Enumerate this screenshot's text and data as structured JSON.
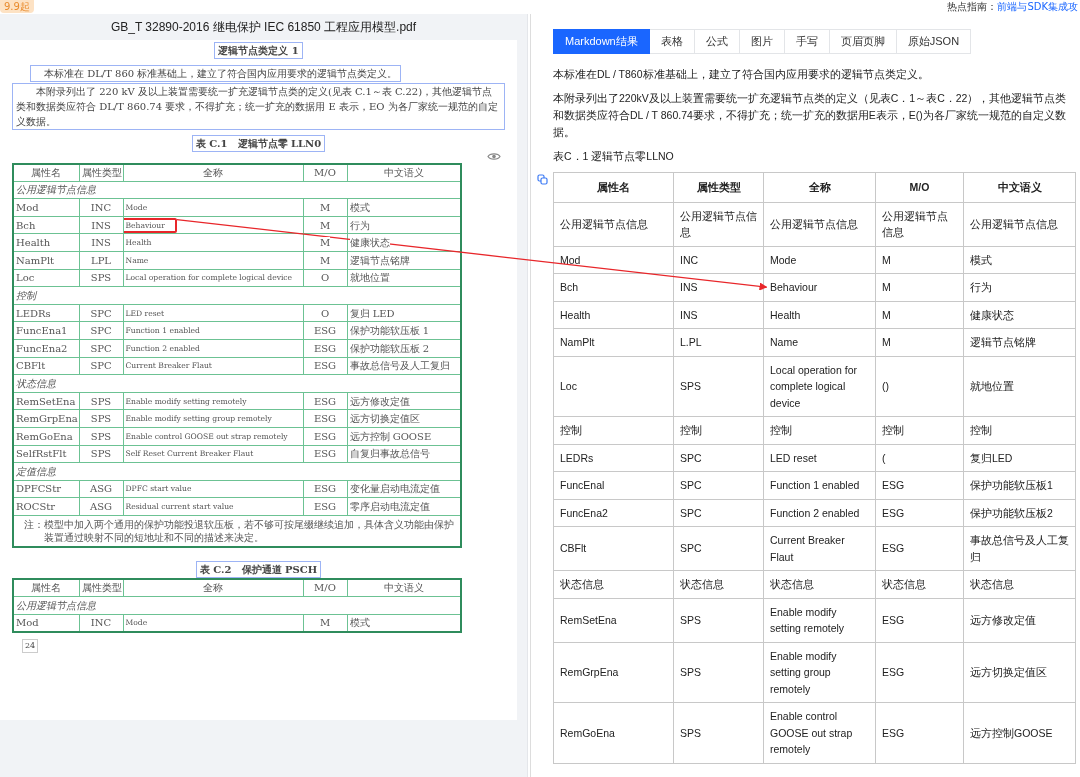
{
  "top_bar": {
    "badge": "9.9起",
    "hint_label": "热点指南：",
    "hint_link": "前端与SDK集成攻"
  },
  "pdf": {
    "title": "GB_T 32890-2016 继电保护 IEC 61850 工程应用模型.pdf",
    "section_title": "逻辑节点类定义 1",
    "paragraphs": [
      "本标准在 DL/T 860 标准基础上，建立了符合国内应用要求的逻辑节点类定义。",
      "本附录列出了 220 kV 及以上装置需要统一扩充逻辑节点类的定义(见表 C.1～表 C.22)，其他逻辑节点类和数据类应符合 DL/T 860.74 要求，不得扩充；统一扩充的数据用 E 表示，EO 为各厂家统一规范的自定义数据。"
    ],
    "tables": [
      {
        "caption": "表 C.1　逻辑节点零 LLN0",
        "columns": [
          "属性名",
          "属性类型",
          "全称",
          "M/O",
          "中文语义"
        ],
        "rows": [
          {
            "kind": "group",
            "label": "公用逻辑节点信息"
          },
          {
            "kind": "row",
            "cells": [
              "Mod",
              "INC",
              "Mode",
              "M",
              "模式"
            ]
          },
          {
            "kind": "row",
            "cells": [
              "Bch",
              "INS",
              "Behaviour",
              "M",
              "行为"
            ],
            "marked": true
          },
          {
            "kind": "row",
            "cells": [
              "Health",
              "INS",
              "Health",
              "M",
              "健康状态"
            ]
          },
          {
            "kind": "row",
            "cells": [
              "NamPlt",
              "LPL",
              "Name",
              "M",
              "逻辑节点铭牌"
            ]
          },
          {
            "kind": "row",
            "cells": [
              "Loc",
              "SPS",
              "Local operation for complete logical device",
              "O",
              "就地位置"
            ]
          },
          {
            "kind": "group",
            "label": "控制"
          },
          {
            "kind": "row",
            "cells": [
              "LEDRs",
              "SPC",
              "LED reset",
              "O",
              "复归 LED"
            ]
          },
          {
            "kind": "row",
            "cells": [
              "FuncEna1",
              "SPC",
              "Function 1 enabled",
              "ESG",
              "保护功能软压板 1"
            ]
          },
          {
            "kind": "row",
            "cells": [
              "FuncEna2",
              "SPC",
              "Function 2 enabled",
              "ESG",
              "保护功能软压板 2"
            ]
          },
          {
            "kind": "row",
            "cells": [
              "CBFlt",
              "SPC",
              "Current Breaker Flaut",
              "ESG",
              "事故总信号及人工复归"
            ]
          },
          {
            "kind": "group",
            "label": "状态信息"
          },
          {
            "kind": "row",
            "cells": [
              "RemSetEna",
              "SPS",
              "Enable modify setting remotely",
              "ESG",
              "远方修改定值"
            ]
          },
          {
            "kind": "row",
            "cells": [
              "RemGrpEna",
              "SPS",
              "Enable modify setting group remotely",
              "ESG",
              "远方切换定值区"
            ]
          },
          {
            "kind": "row",
            "cells": [
              "RemGoEna",
              "SPS",
              "Enable control GOOSE out strap remotely",
              "ESG",
              "远方控制 GOOSE"
            ]
          },
          {
            "kind": "row",
            "cells": [
              "SelfRstFlt",
              "SPS",
              "Self Reset Current Breaker Flaut",
              "ESG",
              "自复归事故总信号"
            ]
          },
          {
            "kind": "group",
            "label": "定值信息"
          },
          {
            "kind": "row",
            "cells": [
              "DPFCStr",
              "ASG",
              "DPFC start value",
              "ESG",
              "变化量启动电流定值"
            ]
          },
          {
            "kind": "row",
            "cells": [
              "ROCStr",
              "ASG",
              "Residual current start value",
              "ESG",
              "零序启动电流定值"
            ]
          },
          {
            "kind": "note",
            "label": "注：模型中加入两个通用的保护功能投退软压板，若不够可按尾缀继续追加，具体含义功能由保护装置通过映射不同的短地址和不同的描述来决定。"
          }
        ]
      },
      {
        "caption": "表 C.2　保护通道 PSCH",
        "columns": [
          "属性名",
          "属性类型",
          "全称",
          "M/O",
          "中文语义"
        ],
        "rows": [
          {
            "kind": "group",
            "label": "公用逻辑节点信息"
          },
          {
            "kind": "row",
            "cells": [
              "Mod",
              "INC",
              "Mode",
              "M",
              "模式"
            ]
          }
        ]
      }
    ],
    "page_number": "24"
  },
  "result": {
    "tabs": [
      {
        "label": "Markdown结果",
        "selected": true
      },
      {
        "label": "表格",
        "selected": false
      },
      {
        "label": "公式",
        "selected": false
      },
      {
        "label": "图片",
        "selected": false
      },
      {
        "label": "手写",
        "selected": false
      },
      {
        "label": "页眉页脚",
        "selected": false
      },
      {
        "label": "原始JSON",
        "selected": false
      }
    ],
    "paragraphs": [
      "本标准在DL / T860标准基础上，建立了符合国内应用要求的逻辑节点类定义。",
      "本附录列出了220kV及以上装置需要统一扩充逻辑节点类的定义（见表C．1～表C．22），其他逻辑节点类和数据类应符合DL / T 860.74要求，不得扩充；统一扩充的数据用E表示，E()为各厂家统一规范的自定义数据。",
      "表C．1 逻辑节点零LLNO"
    ],
    "table": {
      "columns": [
        "属性名",
        "属性类型",
        "全称",
        "M/O",
        "中文语义"
      ],
      "rows": [
        [
          "公用逻辑节点信息",
          "公用逻辑节点信息",
          "公用逻辑节点信息",
          "公用逻辑节点信息",
          "公用逻辑节点信息"
        ],
        [
          "Mod",
          "INC",
          "Mode",
          "M",
          "模式"
        ],
        [
          "Bch",
          "INS",
          "Behaviour",
          "M",
          "行为"
        ],
        [
          "Health",
          "INS",
          "Health",
          "M",
          "健康状态"
        ],
        [
          "NamPlt",
          "L.PL",
          "Name",
          "M",
          "逻辑节点铭牌"
        ],
        [
          "Loc",
          "SPS",
          "Local operation for complete logical device",
          "()",
          "就地位置"
        ],
        [
          "控制",
          "控制",
          "控制",
          "控制",
          "控制"
        ],
        [
          "LEDRs",
          "SPC",
          "LED reset",
          "(",
          "复归LED"
        ],
        [
          "FuncEnal",
          "SPC",
          "Function 1 enabled",
          "ESG",
          "保护功能软压板1"
        ],
        [
          "FuncEna2",
          "SPC",
          "Function 2 enabled",
          "ESG",
          "保护功能软压板2"
        ],
        [
          "CBFlt",
          "SPC",
          "Current Breaker Flaut",
          "ESG",
          "事故总信号及人工复归"
        ],
        [
          "状态信息",
          "状态信息",
          "状态信息",
          "状态信息",
          "状态信息"
        ],
        [
          "RemSetEna",
          "SPS",
          "Enable modify setting remotely",
          "ESG",
          "远方修改定值"
        ],
        [
          "RemGrpEna",
          "SPS",
          "Enable modify setting group remotely",
          "ESG",
          "远方切换定值区"
        ],
        [
          "RemGoEna",
          "SPS",
          "Enable control GOOSE out strap remotely",
          "ESG",
          "远方控制GOOSE"
        ]
      ]
    }
  }
}
